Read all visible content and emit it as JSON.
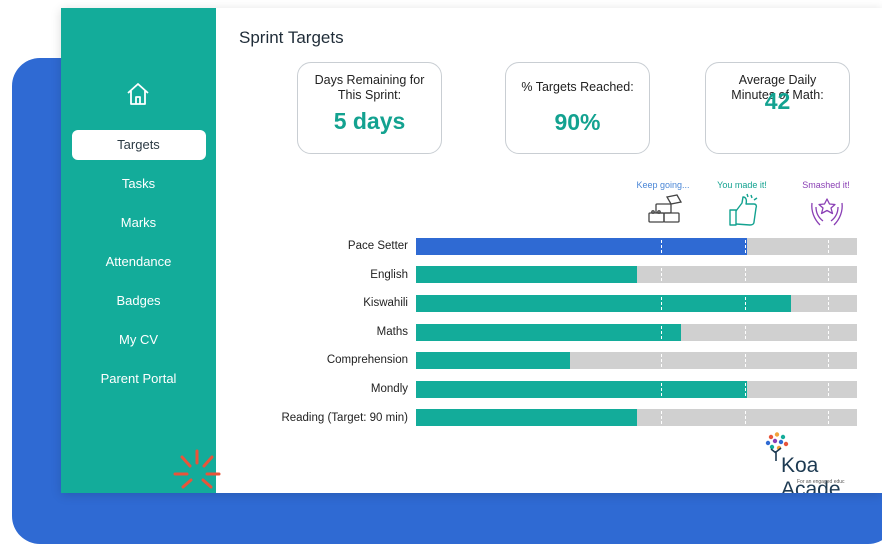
{
  "nav": {
    "items": [
      {
        "label": "Targets",
        "active": true
      },
      {
        "label": "Tasks"
      },
      {
        "label": "Marks"
      },
      {
        "label": "Attendance"
      },
      {
        "label": "Badges"
      },
      {
        "label": "My CV"
      },
      {
        "label": "Parent Portal"
      }
    ]
  },
  "page": {
    "title": "Sprint Targets"
  },
  "cards": [
    {
      "label": "Days Remaining for This Sprint:",
      "value": "5 days"
    },
    {
      "label": "% Targets Reached:",
      "value": "90%"
    },
    {
      "label": "Average Daily Minutes of Math:",
      "value": "42"
    }
  ],
  "milestones": [
    {
      "label": "Keep going...",
      "color": "#4a86d6",
      "icon": "bricks-icon"
    },
    {
      "label": "You made it!",
      "color": "#13a290",
      "icon": "thumbs-up-icon"
    },
    {
      "label": "Smashed it!",
      "color": "#8a3fb5",
      "icon": "star-hands-icon"
    }
  ],
  "progress": {
    "marker_fractions": [
      0.556,
      0.745,
      0.935
    ],
    "rows": [
      {
        "label": "Pace Setter",
        "value": 0.75,
        "color": "#2f6ad3"
      },
      {
        "label": "English",
        "value": 0.5,
        "color": "#13ac9a"
      },
      {
        "label": "Kiswahili",
        "value": 0.85,
        "color": "#13ac9a"
      },
      {
        "label": "Maths",
        "value": 0.6,
        "color": "#13ac9a"
      },
      {
        "label": "Comprehension",
        "value": 0.35,
        "color": "#13ac9a"
      },
      {
        "label": "Mondly",
        "value": 0.75,
        "color": "#13ac9a"
      },
      {
        "label": "Reading (Target: 90 min)",
        "value": 0.5,
        "color": "#13ac9a"
      }
    ]
  },
  "logo": {
    "name": "Koa Acade",
    "tagline": "For an engaged educ"
  },
  "colors": {
    "sidebar": "#13ac9a",
    "accent": "#13a290",
    "backdrop": "#2f6ad3",
    "spark": "#e8543a"
  }
}
